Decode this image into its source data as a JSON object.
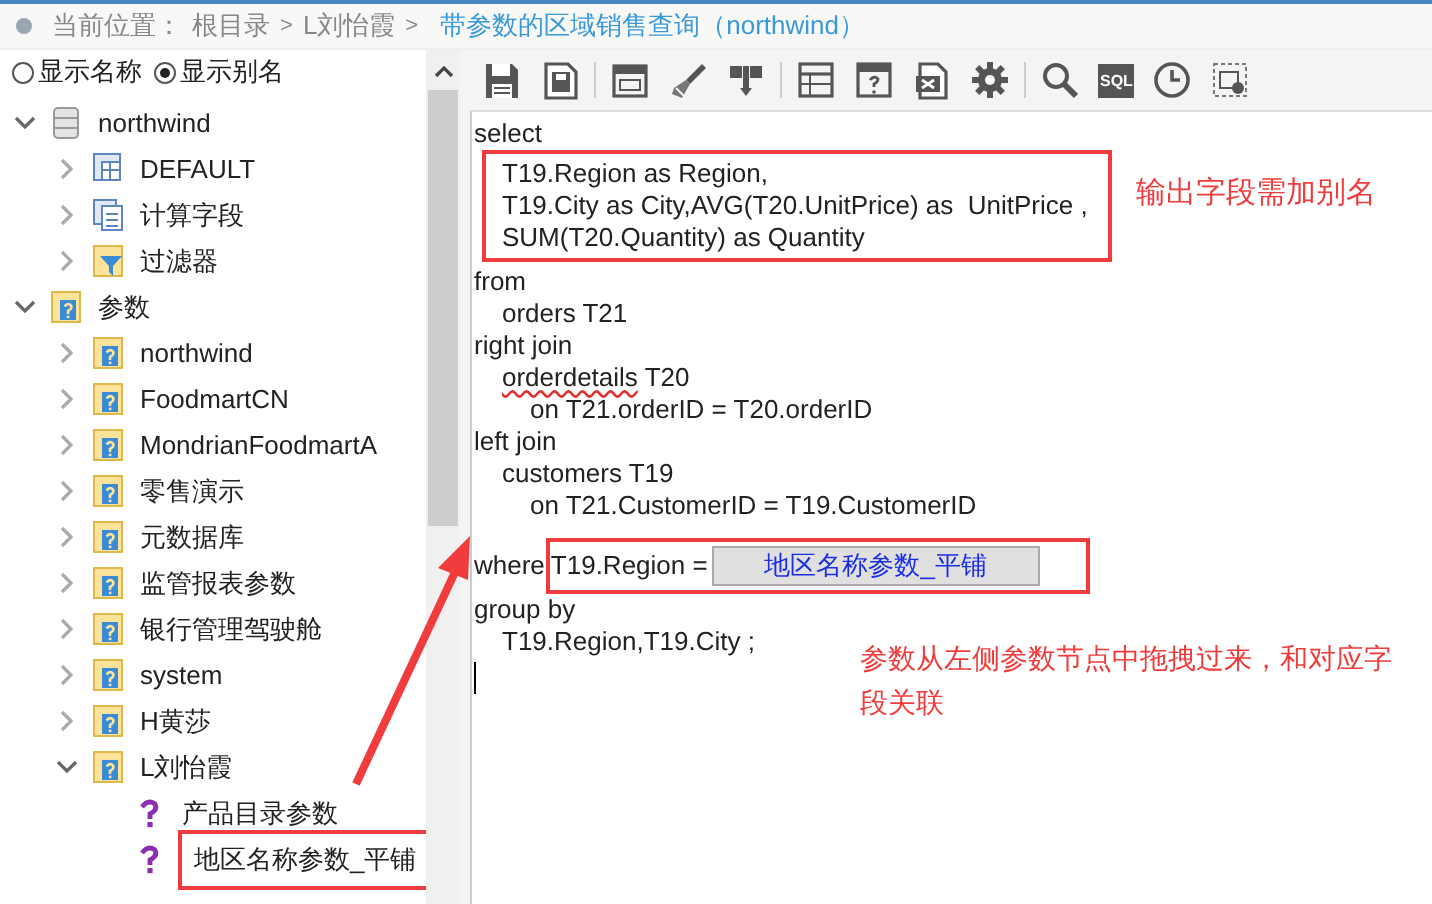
{
  "breadcrumb": {
    "label": "当前位置：",
    "path": [
      {
        "text": "根目录",
        "current": false
      },
      {
        "text": "L刘怡霞",
        "current": false
      },
      {
        "text": "带参数的区域销售查询（northwind）",
        "current": true
      }
    ],
    "separator": ">"
  },
  "display_options": [
    {
      "label": "显示名称",
      "selected": false
    },
    {
      "label": "显示别名",
      "selected": true
    }
  ],
  "tree": [
    {
      "label": "northwind",
      "kind": "database",
      "expanded": true,
      "children": [
        {
          "label": "DEFAULT",
          "kind": "table",
          "expanded": false
        },
        {
          "label": "计算字段",
          "kind": "calc",
          "expanded": false
        },
        {
          "label": "过滤器",
          "kind": "filter",
          "expanded": false
        }
      ]
    },
    {
      "label": "参数",
      "kind": "folder",
      "expanded": true,
      "children": [
        {
          "label": "northwind",
          "kind": "folder",
          "expanded": false
        },
        {
          "label": "FoodmartCN",
          "kind": "folder",
          "expanded": false
        },
        {
          "label": "MondrianFoodmartA",
          "kind": "folder",
          "expanded": false
        },
        {
          "label": "零售演示",
          "kind": "folder",
          "expanded": false
        },
        {
          "label": "元数据库",
          "kind": "folder",
          "expanded": false
        },
        {
          "label": "监管报表参数",
          "kind": "folder",
          "expanded": false
        },
        {
          "label": "银行管理驾驶舱",
          "kind": "folder",
          "expanded": false
        },
        {
          "label": "system",
          "kind": "folder",
          "expanded": false
        },
        {
          "label": "H黄莎",
          "kind": "folder",
          "expanded": false
        },
        {
          "label": "L刘怡霞",
          "kind": "folder",
          "expanded": true,
          "children": [
            {
              "label": "产品目录参数",
              "kind": "param",
              "highlighted": false
            },
            {
              "label": "地区名称参数_平铺",
              "kind": "param",
              "highlighted": true
            }
          ]
        }
      ]
    }
  ],
  "toolbar": [
    {
      "kind": "save"
    },
    {
      "kind": "save-as"
    },
    {
      "kind": "separator"
    },
    {
      "kind": "window"
    },
    {
      "kind": "brush"
    },
    {
      "kind": "merge"
    },
    {
      "kind": "separator"
    },
    {
      "kind": "grid"
    },
    {
      "kind": "help-grid"
    },
    {
      "kind": "export"
    },
    {
      "kind": "gear"
    },
    {
      "kind": "separator"
    },
    {
      "kind": "search"
    },
    {
      "kind": "sql",
      "label": "SQL"
    },
    {
      "kind": "clock"
    },
    {
      "kind": "frame"
    }
  ],
  "sql": [
    {
      "kind": "keyword",
      "text": "select"
    },
    {
      "kind": "group",
      "highlighted": true,
      "note": "输出字段需加别名",
      "lines": [
        {
          "kind": "clause",
          "text": "T19.Region as Region,"
        },
        {
          "kind": "clause",
          "text": "T19.City as City,AVG(T20.UnitPrice) as  UnitPrice ,"
        },
        {
          "kind": "clause",
          "text": "SUM(T20.Quantity) as Quantity"
        }
      ]
    },
    {
      "kind": "keyword",
      "text": "from"
    },
    {
      "kind": "clause",
      "text": "orders T21"
    },
    {
      "kind": "keyword",
      "text": "right join"
    },
    {
      "kind": "clause",
      "misspelled": "orderdetails",
      "text": "T20"
    },
    {
      "kind": "condition",
      "text": "on T21.orderID = T20.orderID"
    },
    {
      "kind": "keyword",
      "text": "left join"
    },
    {
      "kind": "clause",
      "text": "customers T19"
    },
    {
      "kind": "condition",
      "text": "on T21.CustomerID = T19.CustomerID"
    },
    {
      "kind": "param",
      "text": "where",
      "condition": "T19.Region =",
      "param": "地区名称参数_平铺",
      "highlighted": true,
      "note": "参数从左侧参数节点中拖拽过来，和对应字段关联"
    },
    {
      "kind": "keyword",
      "text": "group by"
    },
    {
      "kind": "clause",
      "text": "T19.Region,T19.City ;"
    }
  ]
}
